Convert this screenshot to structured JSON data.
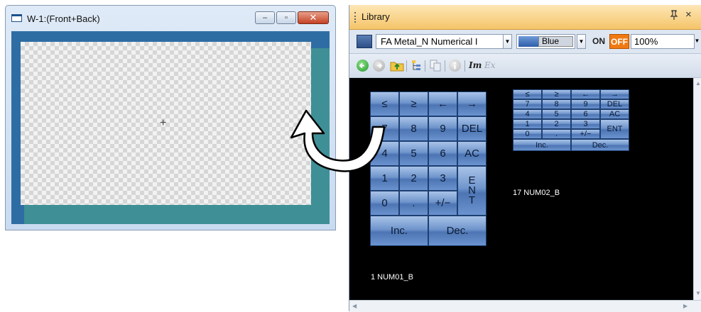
{
  "screen_window": {
    "title": "W-1:(Front+Back)",
    "min_glyph": "–",
    "max_glyph": "▫",
    "close_glyph": "✕",
    "crosshair": "+"
  },
  "library": {
    "title": "Library",
    "pin_glyph": "ᵖ",
    "close_glyph": "×",
    "category": "FA Metal_N Numerical I",
    "color_name": "Blue",
    "on_label": "ON",
    "off_label": "OFF",
    "zoom": "100%",
    "accent_color": "#f07a12"
  },
  "toolbar_icons": [
    "back-icon",
    "forward-icon",
    "up-folder-icon",
    "tree-icon",
    "copy-icon",
    "info-icon",
    "im-icon",
    "ex-icon"
  ],
  "keypad1": {
    "row1": [
      "≤",
      "≥",
      "←",
      "→"
    ],
    "row2": [
      "7",
      "8",
      "9",
      "DEL"
    ],
    "row3": [
      "4",
      "5",
      "6",
      "AC"
    ],
    "row4": [
      "1",
      "2",
      "3"
    ],
    "row5": [
      "0",
      ".",
      "+/−"
    ],
    "ent": [
      "E",
      "N",
      "T"
    ],
    "inc": "Inc.",
    "dec": "Dec.",
    "label": "1 NUM01_B"
  },
  "keypad2": {
    "row1": [
      "≤",
      "≥",
      "←",
      "→"
    ],
    "row2": [
      "7",
      "8",
      "9",
      "DEL"
    ],
    "row3": [
      "4",
      "5",
      "6",
      "AC"
    ],
    "row4": [
      "1",
      "2",
      "3"
    ],
    "row5": [
      "0",
      ".",
      "+/−"
    ],
    "ent": "ENT",
    "inc": "Inc.",
    "dec": "Dec.",
    "label": "17 NUM02_B"
  }
}
